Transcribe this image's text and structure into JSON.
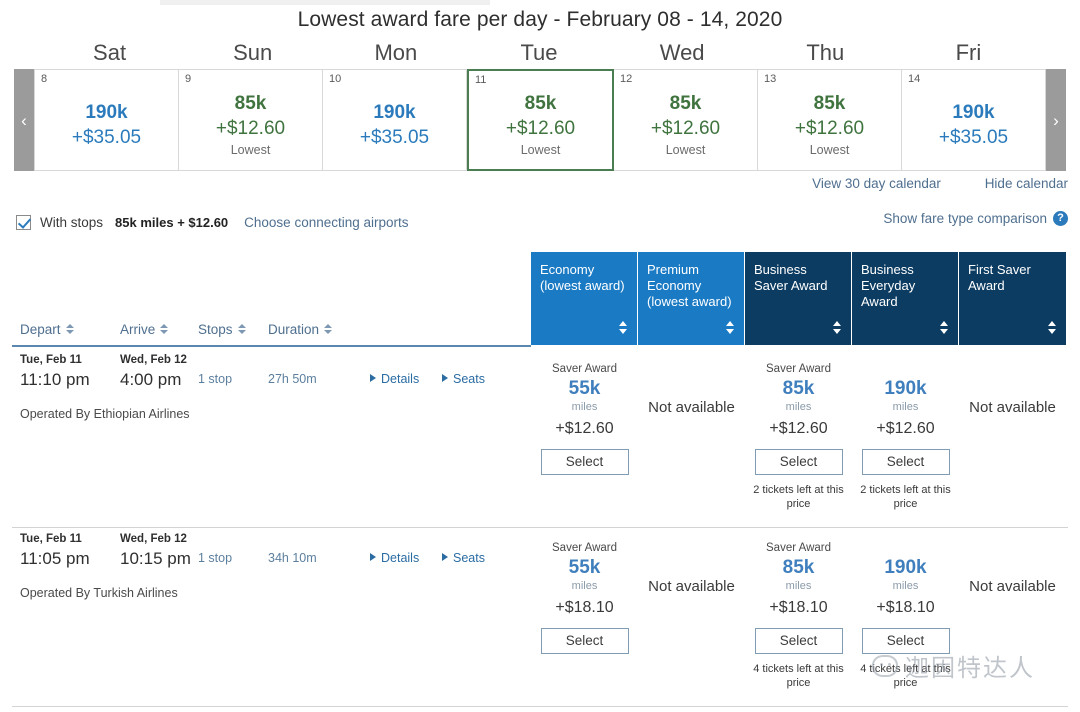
{
  "calendar": {
    "title": "Lowest award fare per day - February 08 - 14, 2020",
    "prev_arrow": "‹",
    "next_arrow": "›",
    "days_of_week": [
      "Sat",
      "Sun",
      "Mon",
      "Tue",
      "Wed",
      "Thu",
      "Fri"
    ],
    "colors": {
      "blue": "#2b7bbc",
      "green": "#40743f",
      "selected_border": "#4a7d52"
    },
    "cells": [
      {
        "day": "8",
        "miles": "190k",
        "cash": "+$35.05",
        "note": "",
        "tone": "blue",
        "selected": false
      },
      {
        "day": "9",
        "miles": "85k",
        "cash": "+$12.60",
        "note": "Lowest",
        "tone": "green",
        "selected": false
      },
      {
        "day": "10",
        "miles": "190k",
        "cash": "+$35.05",
        "note": "",
        "tone": "blue",
        "selected": false
      },
      {
        "day": "11",
        "miles": "85k",
        "cash": "+$12.60",
        "note": "Lowest",
        "tone": "green",
        "selected": true
      },
      {
        "day": "12",
        "miles": "85k",
        "cash": "+$12.60",
        "note": "Lowest",
        "tone": "green",
        "selected": false
      },
      {
        "day": "13",
        "miles": "85k",
        "cash": "+$12.60",
        "note": "Lowest",
        "tone": "green",
        "selected": false
      },
      {
        "day": "14",
        "miles": "190k",
        "cash": "+$35.05",
        "note": "",
        "tone": "blue",
        "selected": false
      }
    ],
    "links": [
      {
        "label": "View 30 day calendar"
      },
      {
        "label": "Hide calendar"
      }
    ]
  },
  "filters": {
    "with_stops_label": "With stops",
    "with_stops_checked": true,
    "with_stops_price": "85k miles + $12.60",
    "connecting_airports_link": "Choose connecting airports",
    "fare_comparison_link": "Show fare type comparison",
    "help_icon_glyph": "?"
  },
  "table": {
    "sort_columns": [
      {
        "label": "Depart"
      },
      {
        "label": "Arrive"
      },
      {
        "label": "Stops"
      },
      {
        "label": "Duration"
      }
    ],
    "fare_columns": [
      {
        "label": "Economy (lowest award)",
        "tone": "light"
      },
      {
        "label": "Premium Economy (lowest award)",
        "tone": "light"
      },
      {
        "label": "Business Saver Award",
        "tone": "dark"
      },
      {
        "label": "Business Everyday Award",
        "tone": "dark"
      },
      {
        "label": "First Saver Award",
        "tone": "dark"
      }
    ],
    "rows": [
      {
        "depart_date": "Tue, Feb 11",
        "depart_time": "11:10 pm",
        "arrive_date": "Wed, Feb 12",
        "arrive_time": "4:00 pm",
        "stops": "1 stop",
        "duration": "27h 50m",
        "details_label": "Details",
        "seats_label": "Seats",
        "operated_by": "Operated By Ethiopian Airlines",
        "fares": [
          {
            "available": true,
            "fare_type": "Saver Award",
            "miles": "55k",
            "unit": "miles",
            "cash": "+$12.60",
            "select_label": "Select",
            "tickets_left": ""
          },
          {
            "available": false,
            "unavailable_label": "Not available"
          },
          {
            "available": true,
            "fare_type": "Saver Award",
            "miles": "85k",
            "unit": "miles",
            "cash": "+$12.60",
            "select_label": "Select",
            "tickets_left": "2 tickets left at this price"
          },
          {
            "available": true,
            "fare_type": "",
            "miles": "190k",
            "unit": "miles",
            "cash": "+$12.60",
            "select_label": "Select",
            "tickets_left": "2 tickets left at this price"
          },
          {
            "available": false,
            "unavailable_label": "Not available"
          }
        ]
      },
      {
        "depart_date": "Tue, Feb 11",
        "depart_time": "11:05 pm",
        "arrive_date": "Wed, Feb 12",
        "arrive_time": "10:15 pm",
        "stops": "1 stop",
        "duration": "34h 10m",
        "details_label": "Details",
        "seats_label": "Seats",
        "operated_by": "Operated By Turkish Airlines",
        "fares": [
          {
            "available": true,
            "fare_type": "Saver Award",
            "miles": "55k",
            "unit": "miles",
            "cash": "+$18.10",
            "select_label": "Select",
            "tickets_left": ""
          },
          {
            "available": false,
            "unavailable_label": "Not available"
          },
          {
            "available": true,
            "fare_type": "Saver Award",
            "miles": "85k",
            "unit": "miles",
            "cash": "+$18.10",
            "select_label": "Select",
            "tickets_left": "4 tickets left at this price"
          },
          {
            "available": true,
            "fare_type": "",
            "miles": "190k",
            "unit": "miles",
            "cash": "+$18.10",
            "select_label": "Select",
            "tickets_left": "4 tickets left at this price"
          },
          {
            "available": false,
            "unavailable_label": "Not available"
          }
        ]
      }
    ]
  },
  "watermark": {
    "text": "迦因特达人"
  }
}
